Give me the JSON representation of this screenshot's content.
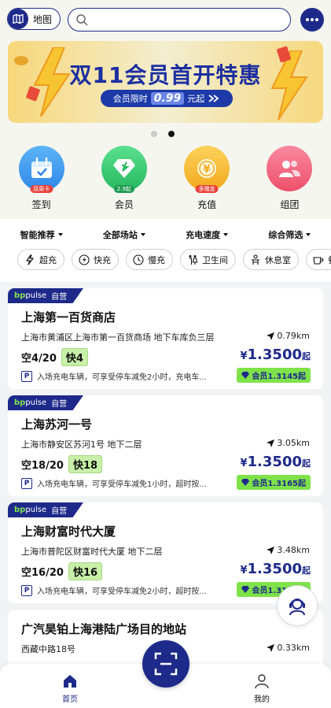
{
  "header": {
    "map_label": "地图",
    "search_placeholder": ""
  },
  "banner": {
    "title": "双11会员首开特惠",
    "pill_prefix": "会员限时",
    "pill_price": "0.99",
    "pill_suffix": "元起"
  },
  "carousel": {
    "count": 2,
    "active": 1
  },
  "quick": [
    {
      "label": "签到",
      "tag": "双周卡",
      "color": "#3b9df0"
    },
    {
      "label": "会员",
      "tag": "2.9起",
      "color": "#3dcf76"
    },
    {
      "label": "充值",
      "tag": "多赠金",
      "color": "#f5b82a"
    },
    {
      "label": "组团",
      "tag": "",
      "color": "#f2647a"
    }
  ],
  "filters": {
    "sort": "智能推荐",
    "scope": "全部场站",
    "speed": "充电速度",
    "combined": "综合筛选"
  },
  "chips": [
    "超充",
    "快充",
    "慢充",
    "卫生间",
    "休息室",
    "餐饮"
  ],
  "stations": [
    {
      "brand": "pulse",
      "brand_type": "自营",
      "name": "上海第一百货商店",
      "address": "上海市黄浦区上海市第一百货商场 地下车库负三层",
      "distance": "0.79km",
      "free_label": "空",
      "free": "4/20",
      "fast_label": "快",
      "fast": "4",
      "price_symbol": "¥",
      "price": "1.3500",
      "price_unit": "起",
      "parking": "入场充电车辆，可享受停车减免2小时，充电车...",
      "member_price": "会员1.3145起"
    },
    {
      "brand": "pulse",
      "brand_type": "自营",
      "name": "上海苏河一号",
      "address": "上海市静安区苏河1号 地下二层",
      "distance": "3.05km",
      "free_label": "空",
      "free": "18/20",
      "fast_label": "快",
      "fast": "18",
      "price_symbol": "¥",
      "price": "1.3500",
      "price_unit": "起",
      "parking": "入场充电车辆，可享受停车减免1小时，超时按...",
      "member_price": "会员1.3165起"
    },
    {
      "brand": "pulse",
      "brand_type": "自营",
      "name": "上海财富时代大厦",
      "address": "上海市普陀区财富时代大厦 地下二层",
      "distance": "3.48km",
      "free_label": "空",
      "free": "16/20",
      "fast_label": "快",
      "fast": "16",
      "price_symbol": "¥",
      "price": "1.3500",
      "price_unit": "起",
      "parking": "入场充电车辆，可享受停车减免2小时，超时按...",
      "member_price": "会员1.3195起"
    },
    {
      "name": "广汽昊铂上海港陆广场目的地站",
      "address": "西藏中路18号",
      "distance": "0.33km"
    }
  ],
  "nav": {
    "home": "首页",
    "mine": "我的"
  },
  "colors": {
    "brand_blue": "#1e2a8a",
    "member_green": "#7fe24a"
  }
}
